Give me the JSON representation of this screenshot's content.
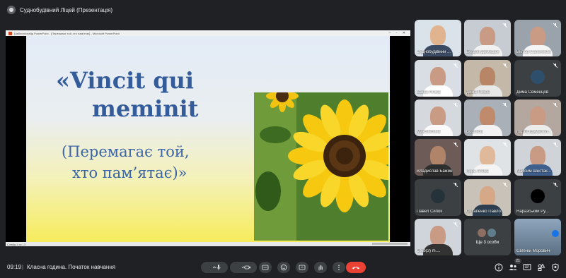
{
  "meeting": {
    "header_title": "Суднобудівний Ліцей (Презентація)",
    "time": "09:19",
    "separator": "|",
    "title": "Класна година. Початок навчання"
  },
  "powerpoint": {
    "window_title": "Шаблон/слайд PowerPoint  -  [Перемагає той, хто пам'ятає]  -  Microsoft PowerPoint",
    "slide_counter": "Слайд 1 из 13"
  },
  "slide": {
    "line1": "«Vincit qui",
    "line2": "meminit",
    "line3": "(Перемагає той,",
    "line4": "хто пам’ятає)»"
  },
  "participants": [
    {
      "name": "Суднобудівний ..."
    },
    {
      "name": "Богдан Демидюк"
    },
    {
      "name": "Віктор Сальников"
    },
    {
      "name": "Саша Атосв"
    },
    {
      "name": "Дима Пикон"
    },
    {
      "name": "Дима Семенцов"
    },
    {
      "name": "Максвелина"
    },
    {
      "name": "Bodhikss"
    },
    {
      "name": "mq Яструмвітел..."
    },
    {
      "name": "Владислав Бажин"
    },
    {
      "name": "Ігорь Агема"
    },
    {
      "name": "Максим Шестак..."
    },
    {
      "name": "Павел Сипок"
    },
    {
      "name": "Остапенко Павло"
    },
    {
      "name": "Наразський Ру..."
    },
    {
      "name": "Gleb(3) m...."
    },
    {
      "name": "Ще 3 особи"
    },
    {
      "name": "Євгеній Морович"
    }
  ],
  "participant_count": "21",
  "colors": {
    "background": "#202124",
    "tile": "#3c4043",
    "end_call": "#ea4335",
    "active_outline": "#8ab4f8",
    "slide_title": "#355c9a"
  }
}
